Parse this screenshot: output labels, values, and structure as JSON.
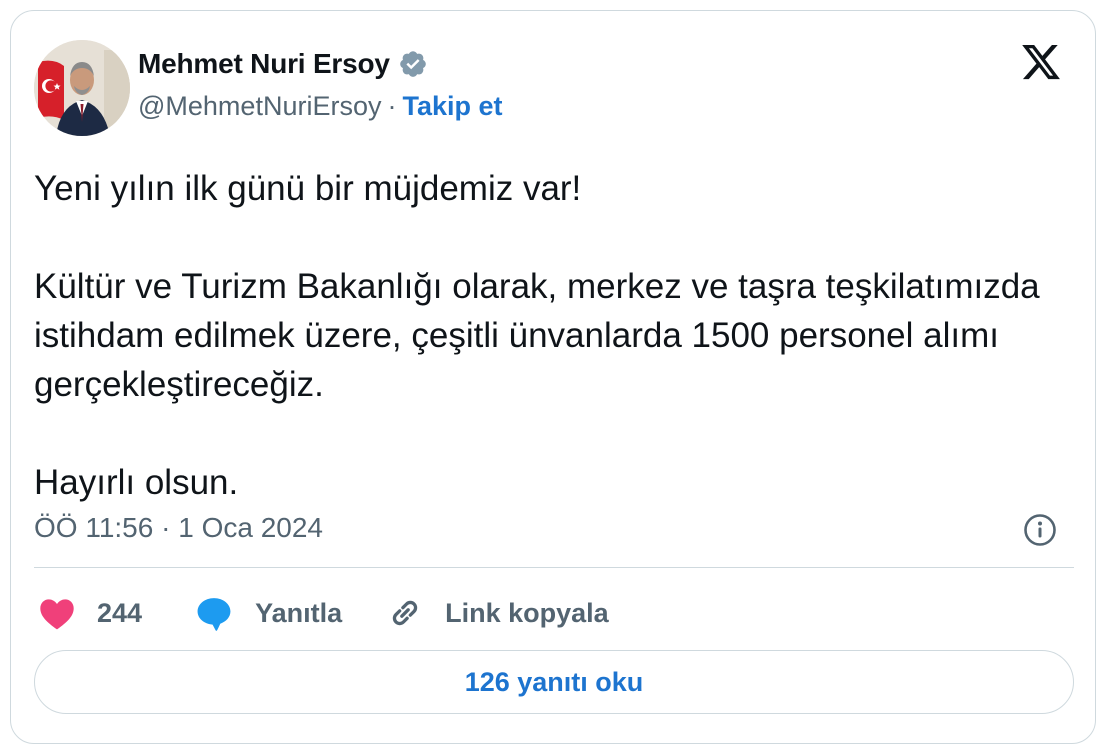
{
  "author": {
    "name": "Mehmet Nuri Ersoy",
    "handle": "@MehmetNuriErsoy",
    "separator": "·",
    "follow_label": "Takip et"
  },
  "tweet": {
    "text": "Yeni yılın ilk günü bir müjdemiz var!\n\nKültür ve Turizm Bakanlığı olarak, merkez ve taşra teşkilatımızda istihdam edilmek üzere, çeşitli ünvanlarda 1500 personel alımı gerçekleştireceğiz.\n\nHayırlı olsun.",
    "timestamp": "ÖÖ 11:56 · 1 Oca 2024"
  },
  "actions": {
    "like_count": "244",
    "reply_label": "Yanıtla",
    "copy_link_label": "Link kopyala"
  },
  "read_replies_label": "126 yanıtı oku",
  "icons": {
    "verified": "verified-badge-icon",
    "platform": "x-logo-icon",
    "info": "info-icon",
    "like": "heart-icon",
    "reply": "speech-bubble-icon",
    "copy_link": "link-icon"
  },
  "colors": {
    "link_blue": "#1d74cf",
    "heart": "#f0407a",
    "reply_bubble": "#1d9bf0",
    "muted_text": "#536471",
    "border": "#cfd9de",
    "verified_badge": "#829aab"
  }
}
